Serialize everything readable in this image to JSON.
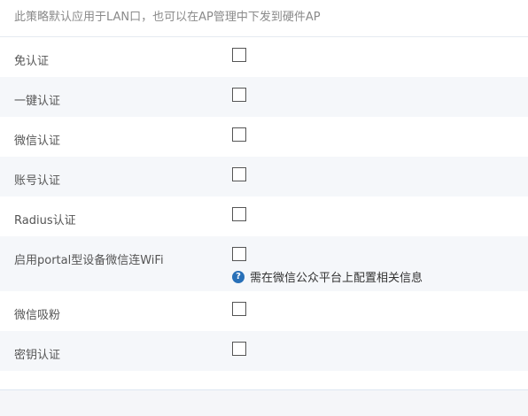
{
  "notice": "此策略默认应用于LAN口，也可以在AP管理中下发到硬件AP",
  "options": [
    {
      "label": "免认证",
      "checked": false
    },
    {
      "label": "一键认证",
      "checked": false
    },
    {
      "label": "微信认证",
      "checked": false
    },
    {
      "label": "账号认证",
      "checked": false
    },
    {
      "label": "Radius认证",
      "checked": false
    },
    {
      "label": "启用portal型设备微信连WiFi",
      "checked": false,
      "hint": "需在微信公众平台上配置相关信息"
    },
    {
      "label": "微信吸粉",
      "checked": false
    },
    {
      "label": "密钥认证",
      "checked": false
    }
  ],
  "icons": {
    "help": "question-circle-icon"
  },
  "colors": {
    "help_icon": "#2870b8",
    "shaded_row": "#f5f7fa"
  }
}
